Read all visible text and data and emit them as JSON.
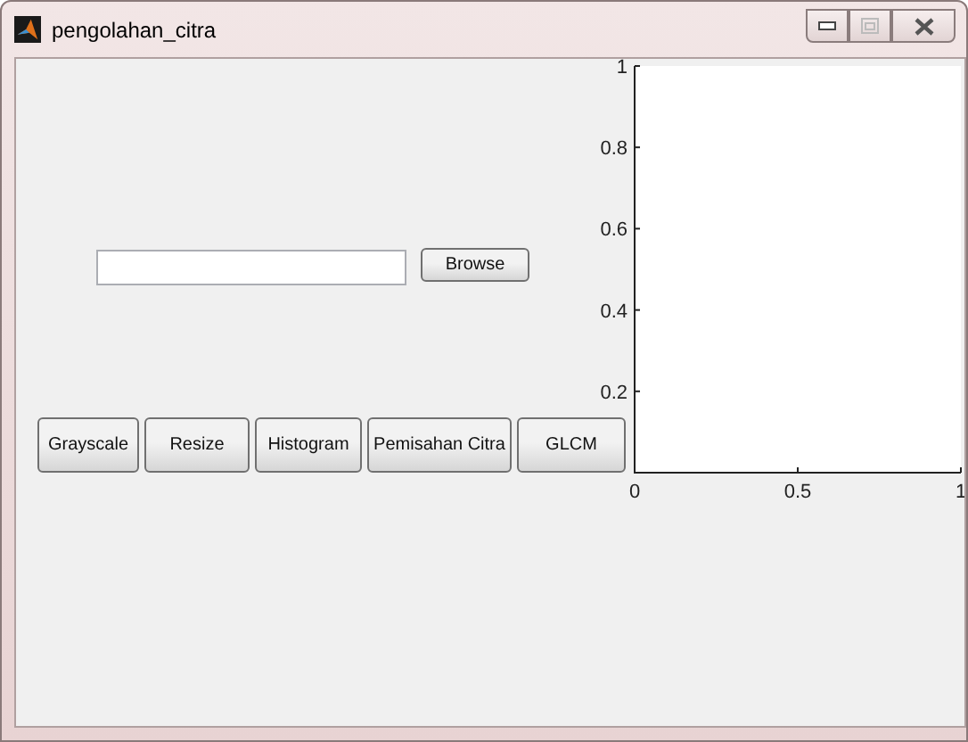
{
  "window": {
    "title": "pengolahan_citra"
  },
  "browse_button": {
    "label": "Browse"
  },
  "buttons": [
    {
      "label": "Grayscale"
    },
    {
      "label": "Resize"
    },
    {
      "label": "Histogram"
    },
    {
      "label": "Pemisahan Citra"
    },
    {
      "label": "GLCM"
    }
  ],
  "axes": {
    "chart_data": {
      "type": "line",
      "xlim": [
        0,
        1
      ],
      "ylim": [
        0,
        1
      ],
      "xticks": [
        0,
        0.5,
        1
      ],
      "yticks": [
        0.2,
        0.4,
        0.6,
        0.8,
        1
      ]
    }
  }
}
